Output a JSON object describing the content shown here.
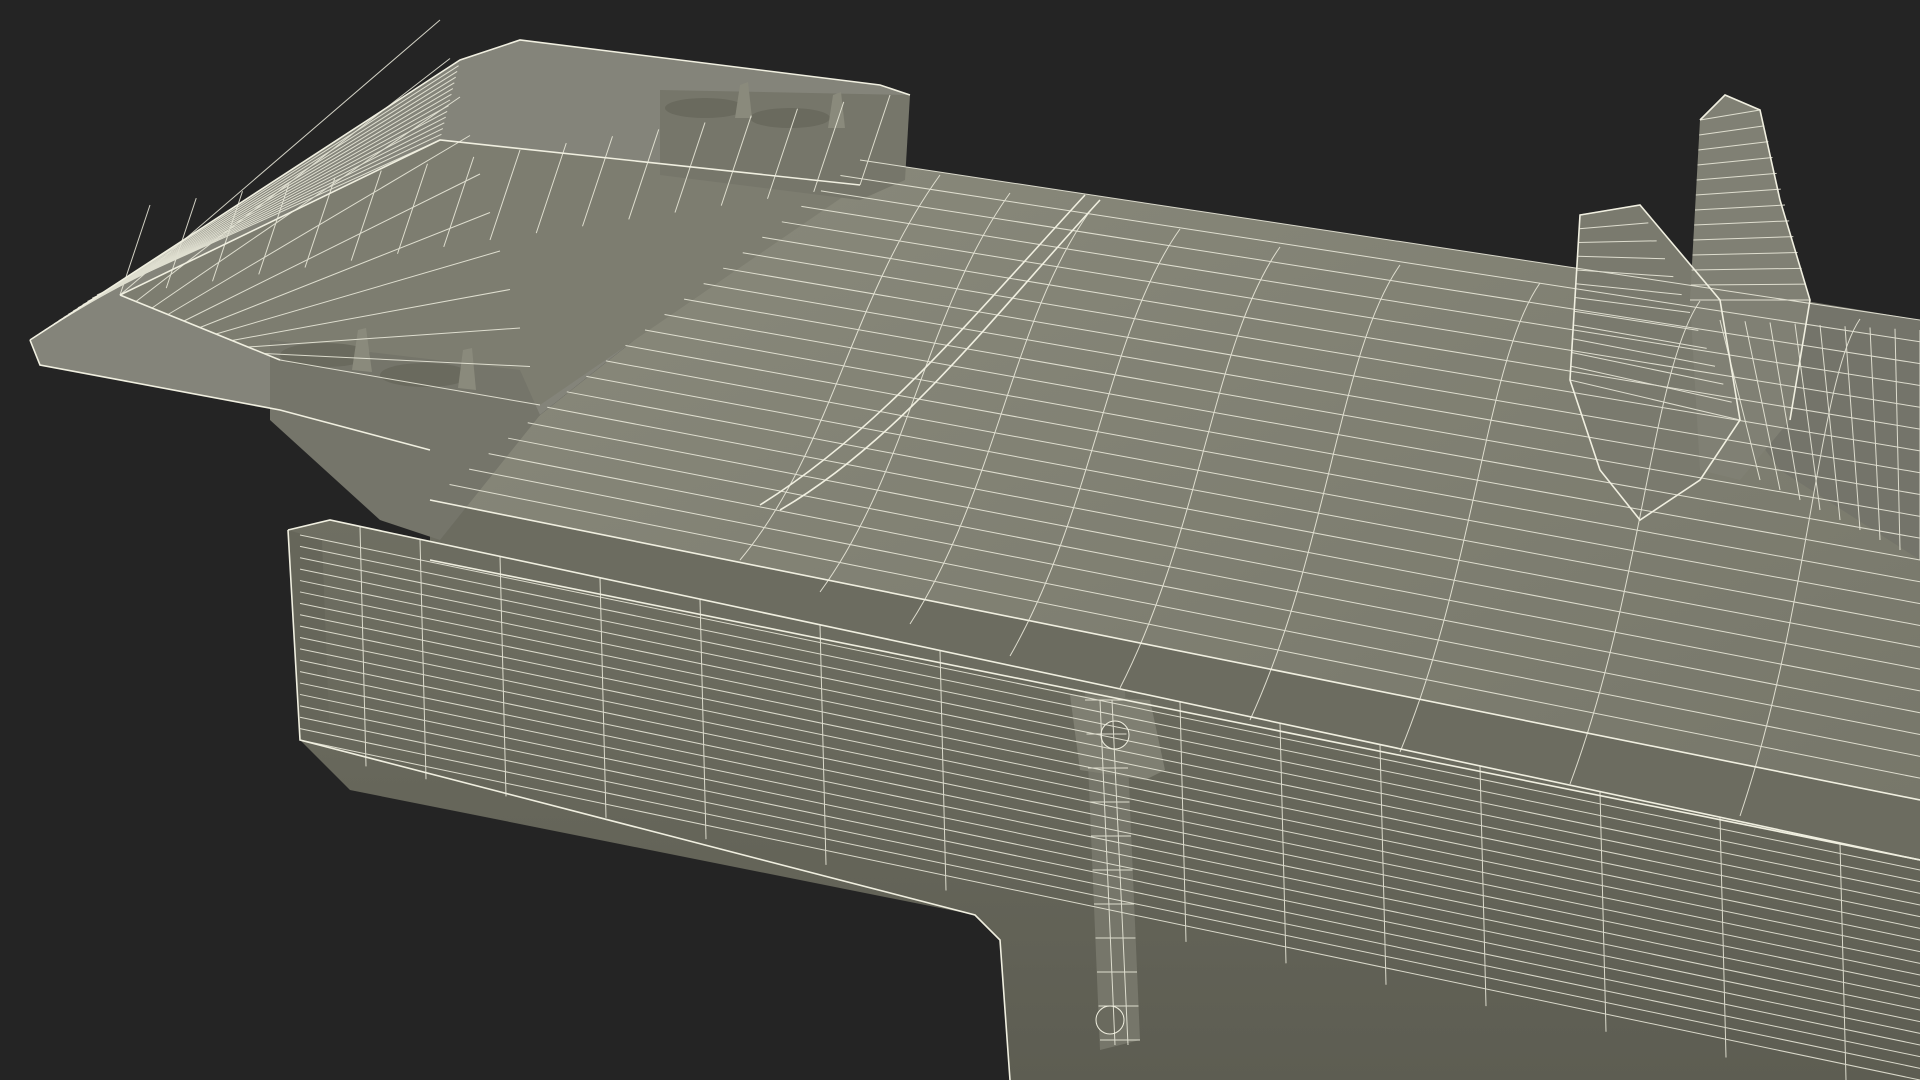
{
  "scene": {
    "subject": "wireframe-render",
    "colors": {
      "background": "#242424",
      "surface": "#7a7a6c",
      "surface_light": "#8a8a7c",
      "surface_dark": "#5f5f54",
      "wire": "#f0efe0"
    }
  }
}
